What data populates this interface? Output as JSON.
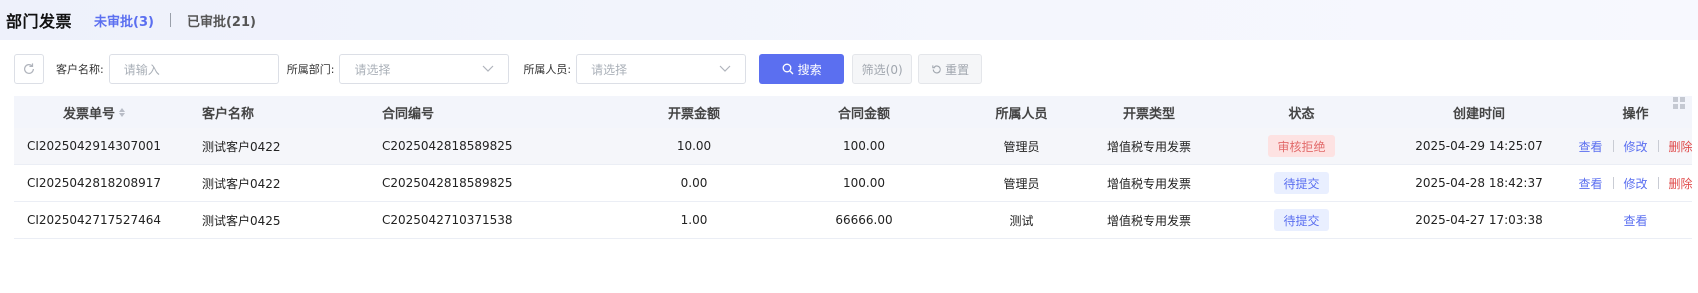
{
  "header": {
    "title": "部门发票",
    "tab_pending": "未审批(3)",
    "tab_approved": "已审批(21)"
  },
  "filters": {
    "customer_label": "客户名称:",
    "customer_placeholder": "请输入",
    "dept_label": "所属部门:",
    "dept_placeholder": "请选择",
    "person_label": "所属人员:",
    "person_placeholder": "请选择",
    "search_label": "搜索",
    "filter_label": "筛选(0)",
    "reset_label": "重置"
  },
  "table": {
    "columns": [
      "发票单号",
      "客户名称",
      "合同编号",
      "开票金额",
      "合同金额",
      "所属人员",
      "开票类型",
      "状态",
      "创建时间",
      "操作"
    ],
    "rows": [
      {
        "invoice_no": "CI2025042914307001",
        "customer": "测试客户0422",
        "contract_no": "C2025042818589825",
        "invoice_amount": "10.00",
        "contract_amount": "100.00",
        "person": "管理员",
        "type": "增值税专用发票",
        "status": "审核拒绝",
        "status_kind": "reject",
        "created": "2025-04-29 14:25:07",
        "ops": {
          "view": "查看",
          "edit": "修改",
          "delete": "删除"
        }
      },
      {
        "invoice_no": "CI2025042818208917",
        "customer": "测试客户0422",
        "contract_no": "C2025042818589825",
        "invoice_amount": "0.00",
        "contract_amount": "100.00",
        "person": "管理员",
        "type": "增值税专用发票",
        "status": "待提交",
        "status_kind": "pending",
        "created": "2025-04-28 18:42:37",
        "ops": {
          "view": "查看",
          "edit": "修改",
          "delete": "删除"
        }
      },
      {
        "invoice_no": "CI2025042717527464",
        "customer": "测试客户0425",
        "contract_no": "C2025042710371538",
        "invoice_amount": "1.00",
        "contract_amount": "66666.00",
        "person": "测试",
        "type": "增值税专用发票",
        "status": "待提交",
        "status_kind": "pending",
        "created": "2025-04-27 17:03:38",
        "ops": {
          "view": "查看"
        }
      }
    ]
  },
  "colors": {
    "accent": "#5b6ff0",
    "danger": "#e04b4b",
    "reject_bg": "#fde2e2",
    "pending_bg": "#e9efff"
  },
  "icons": [
    "refresh-icon",
    "chevron-down-icon",
    "search-icon",
    "reset-icon",
    "sort-icon",
    "grid-settings-icon"
  ]
}
